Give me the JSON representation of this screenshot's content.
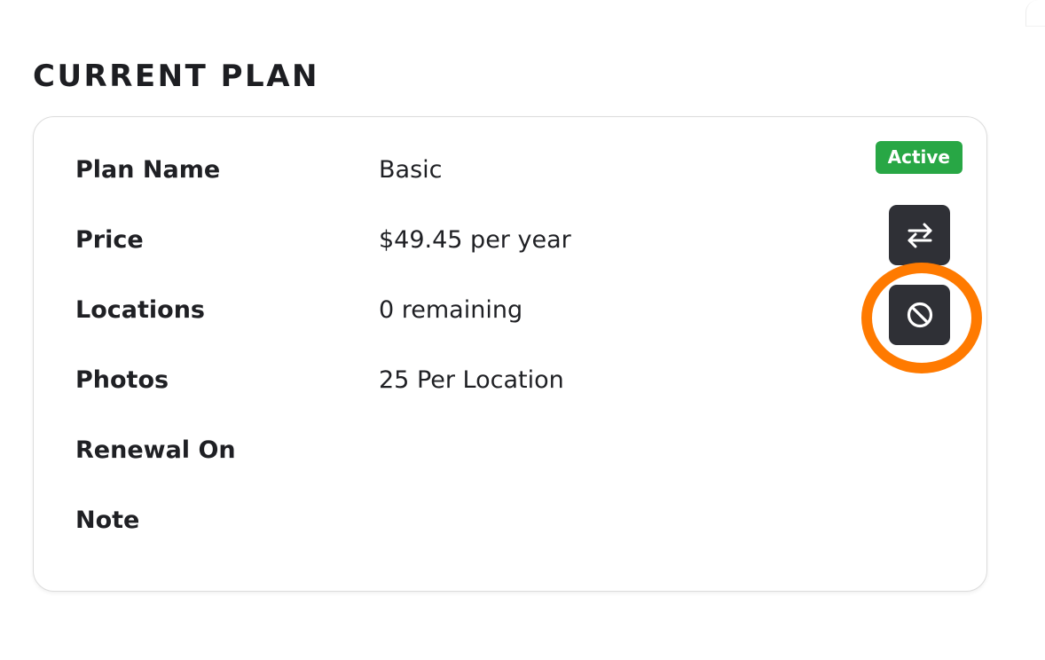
{
  "section": {
    "title": "CURRENT PLAN"
  },
  "plan": {
    "status": "Active",
    "rows": [
      {
        "label": "Plan Name",
        "value": "Basic"
      },
      {
        "label": "Price",
        "value": "$49.45 per year"
      },
      {
        "label": "Locations",
        "value": "0 remaining"
      },
      {
        "label": "Photos",
        "value": "25 Per Location"
      },
      {
        "label": "Renewal On",
        "value": ""
      },
      {
        "label": "Note",
        "value": ""
      }
    ]
  },
  "actions": {
    "switch_icon": "swap-arrows-icon",
    "cancel_icon": "ban-icon"
  },
  "colors": {
    "status_active": "#28a745",
    "button_dark": "#2f3036",
    "highlight": "#ff7a00"
  }
}
